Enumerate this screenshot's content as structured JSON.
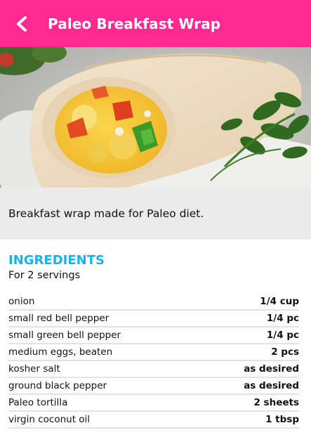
{
  "header": {
    "title": "Paleo Breakfast Wrap",
    "back_icon": "chevron-left-icon",
    "background_color": "#ff2a91"
  },
  "hero_image": {
    "subject": "photo of a tortilla wrap filled with scrambled eggs and peppers, parsley on a plate"
  },
  "description": "Breakfast wrap made for Paleo diet.",
  "ingredients": {
    "heading": "INGREDIENTS",
    "heading_color": "#19b3e6",
    "servings": "For 2 servings",
    "items": [
      {
        "name": "onion",
        "qty": "1/4 cup"
      },
      {
        "name": "small red bell pepper",
        "qty": "1/4 pc"
      },
      {
        "name": "small green bell pepper",
        "qty": "1/4 pc"
      },
      {
        "name": "medium eggs, beaten",
        "qty": "2 pcs"
      },
      {
        "name": "kosher salt",
        "qty": "as desired"
      },
      {
        "name": "ground black pepper",
        "qty": "as desired"
      },
      {
        "name": "Paleo tortilla",
        "qty": "2 sheets"
      },
      {
        "name": "virgin coconut oil",
        "qty": "1 tbsp"
      }
    ]
  }
}
